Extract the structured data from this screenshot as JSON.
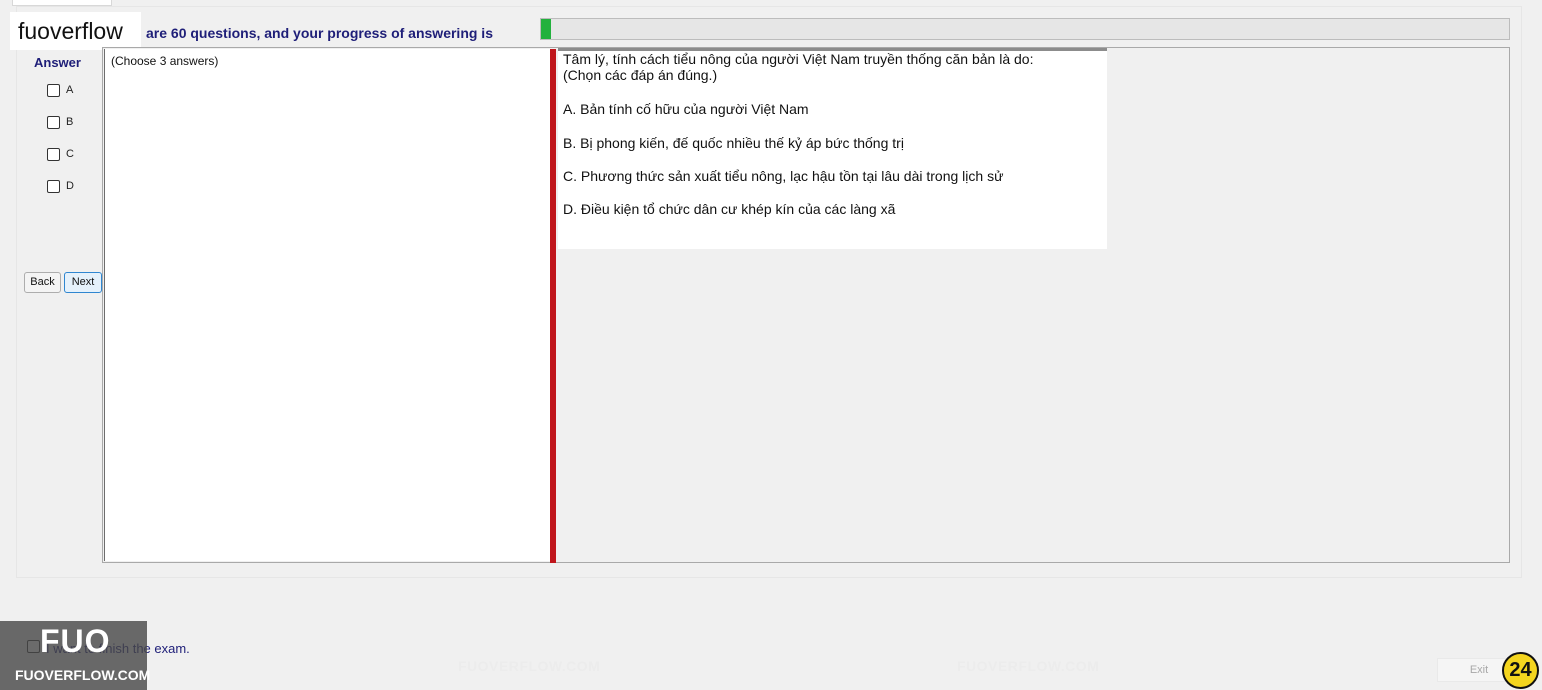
{
  "header": {
    "brand": "fuoverflow",
    "progress_text": "are 60 questions, and your progress of answering is",
    "progress_fraction": 0.01
  },
  "answer_panel": {
    "title": "Answer",
    "options": [
      "A",
      "B",
      "C",
      "D"
    ],
    "back_label": "Back",
    "next_label": "Next"
  },
  "question": {
    "hint": "(Choose 3 answers)",
    "stem_line1": "Tâm lý, tính cách tiểu nông của người Việt Nam truyền thống căn bản là do:",
    "stem_line2": "(Chọn các đáp án đúng.)",
    "options": [
      "A.  Bản tính cố hữu của người Việt Nam",
      "B.  Bị phong kiến, đế quốc nhiều thế kỷ áp bức thống trị",
      "C.  Phương thức sản xuất tiểu nông, lạc hậu tồn tại lâu dài trong lịch sử",
      "D.  Điều kiện tổ chức dân cư khép kín của các làng xã"
    ]
  },
  "watermark": {
    "text": "FUOVERFLOW.COM"
  },
  "footer": {
    "finish_text": "I want to finish the exam.",
    "logo_big": "FUO",
    "logo_url": "FUOVERFLOW.COM",
    "exit_label": "Exit",
    "page_number": "24"
  },
  "colors": {
    "progress": "#22b13d",
    "divider": "#c0161c",
    "label_text": "#1e1e78",
    "badge": "#f4d51f"
  }
}
